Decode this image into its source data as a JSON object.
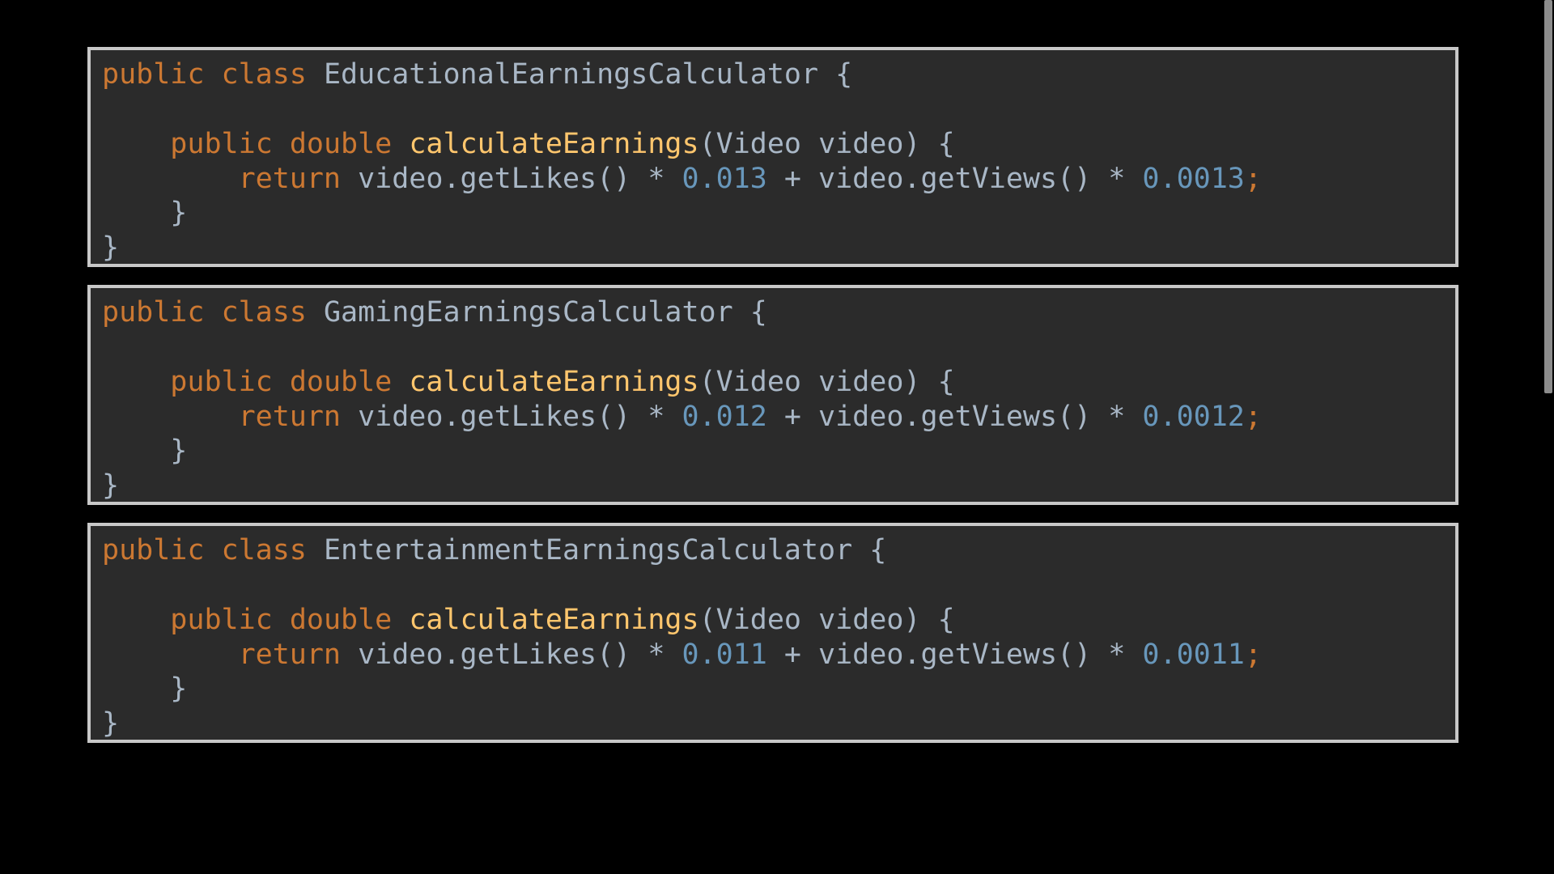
{
  "blocks": [
    {
      "class_line": {
        "k1": "public",
        "k2": "class",
        "name": "EducationalEarningsCalculator",
        "brace": "{"
      },
      "method_line": {
        "k1": "public",
        "k2": "double",
        "fn": "calculateEarnings",
        "params": "(Video video) {"
      },
      "return_line": {
        "kw": "return",
        "expr1": "video.getLikes() * ",
        "n1": "0.013",
        "expr2": " + video.getViews() * ",
        "n2": "0.0013",
        "semi": ";"
      },
      "close_method": "}",
      "close_class": "}"
    },
    {
      "class_line": {
        "k1": "public",
        "k2": "class",
        "name": "GamingEarningsCalculator",
        "brace": "{"
      },
      "method_line": {
        "k1": "public",
        "k2": "double",
        "fn": "calculateEarnings",
        "params": "(Video video) {"
      },
      "return_line": {
        "kw": "return",
        "expr1": "video.getLikes() * ",
        "n1": "0.012",
        "expr2": " + video.getViews() * ",
        "n2": "0.0012",
        "semi": ";"
      },
      "close_method": "}",
      "close_class": "}"
    },
    {
      "class_line": {
        "k1": "public",
        "k2": "class",
        "name": "EntertainmentEarningsCalculator",
        "brace": "{"
      },
      "method_line": {
        "k1": "public",
        "k2": "double",
        "fn": "calculateEarnings",
        "params": "(Video video) {"
      },
      "return_line": {
        "kw": "return",
        "expr1": "video.getLikes() * ",
        "n1": "0.011",
        "expr2": " + video.getViews() * ",
        "n2": "0.0011",
        "semi": ";"
      },
      "close_method": "}",
      "close_class": "}"
    }
  ],
  "colors": {
    "keyword": "#cc7832",
    "function": "#ffc66d",
    "number": "#6897bb",
    "text": "#a9b7c6",
    "editor_bg": "#2b2b2b",
    "border": "#c8c8c8"
  }
}
